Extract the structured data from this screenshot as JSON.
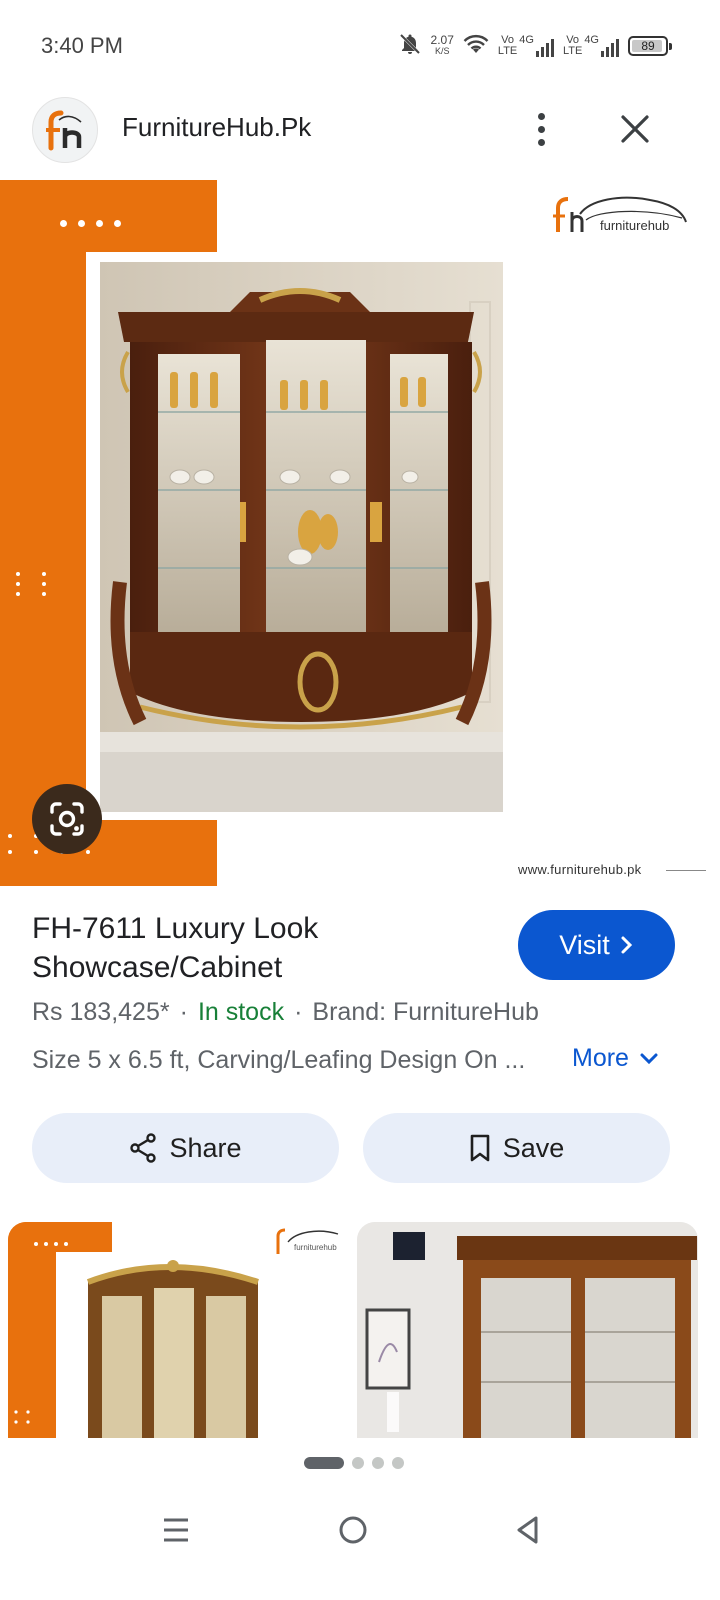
{
  "status_bar": {
    "time": "3:40 PM",
    "speed_value": "2.07",
    "speed_unit": "K/S",
    "sim1_label": "Vo\nLTE",
    "sim1_net": "4G",
    "sim2_label": "Vo\nLTE",
    "sim2_net": "4G",
    "battery": "89",
    "icons": [
      "bell-muted-icon",
      "wifi-icon",
      "signal-icon",
      "battery-icon"
    ]
  },
  "header": {
    "site_name": "FurnitureHub.Pk",
    "logo_icon": "fh-logo-icon",
    "menu_icon": "more-vert-icon",
    "close_icon": "close-icon"
  },
  "hero": {
    "brand_text": "furniturehub",
    "watermark_url": "www.furniturehub.pk",
    "lens_icon": "google-lens-icon",
    "colors": {
      "accent_orange": "#e8710d"
    }
  },
  "product": {
    "title_line1": "FH-7611 Luxury Look",
    "title_line2": "Showcase/Cabinet",
    "visit_label": "Visit",
    "price": "Rs 183,425*",
    "separator": "·",
    "stock": "In stock",
    "brand": "Brand: FurnitureHub",
    "description": "Size 5 x 6.5 ft, Carving/Leafing Design On ...",
    "more_label": "More"
  },
  "actions": {
    "share_label": "Share",
    "save_label": "Save"
  },
  "related": {
    "card1_brand": "furniturehub",
    "pager_count": 4,
    "pager_active": 1
  },
  "colors": {
    "primary_blue": "#0b57d0",
    "in_stock_green": "#188038",
    "chip_bg": "#e8eef9"
  }
}
